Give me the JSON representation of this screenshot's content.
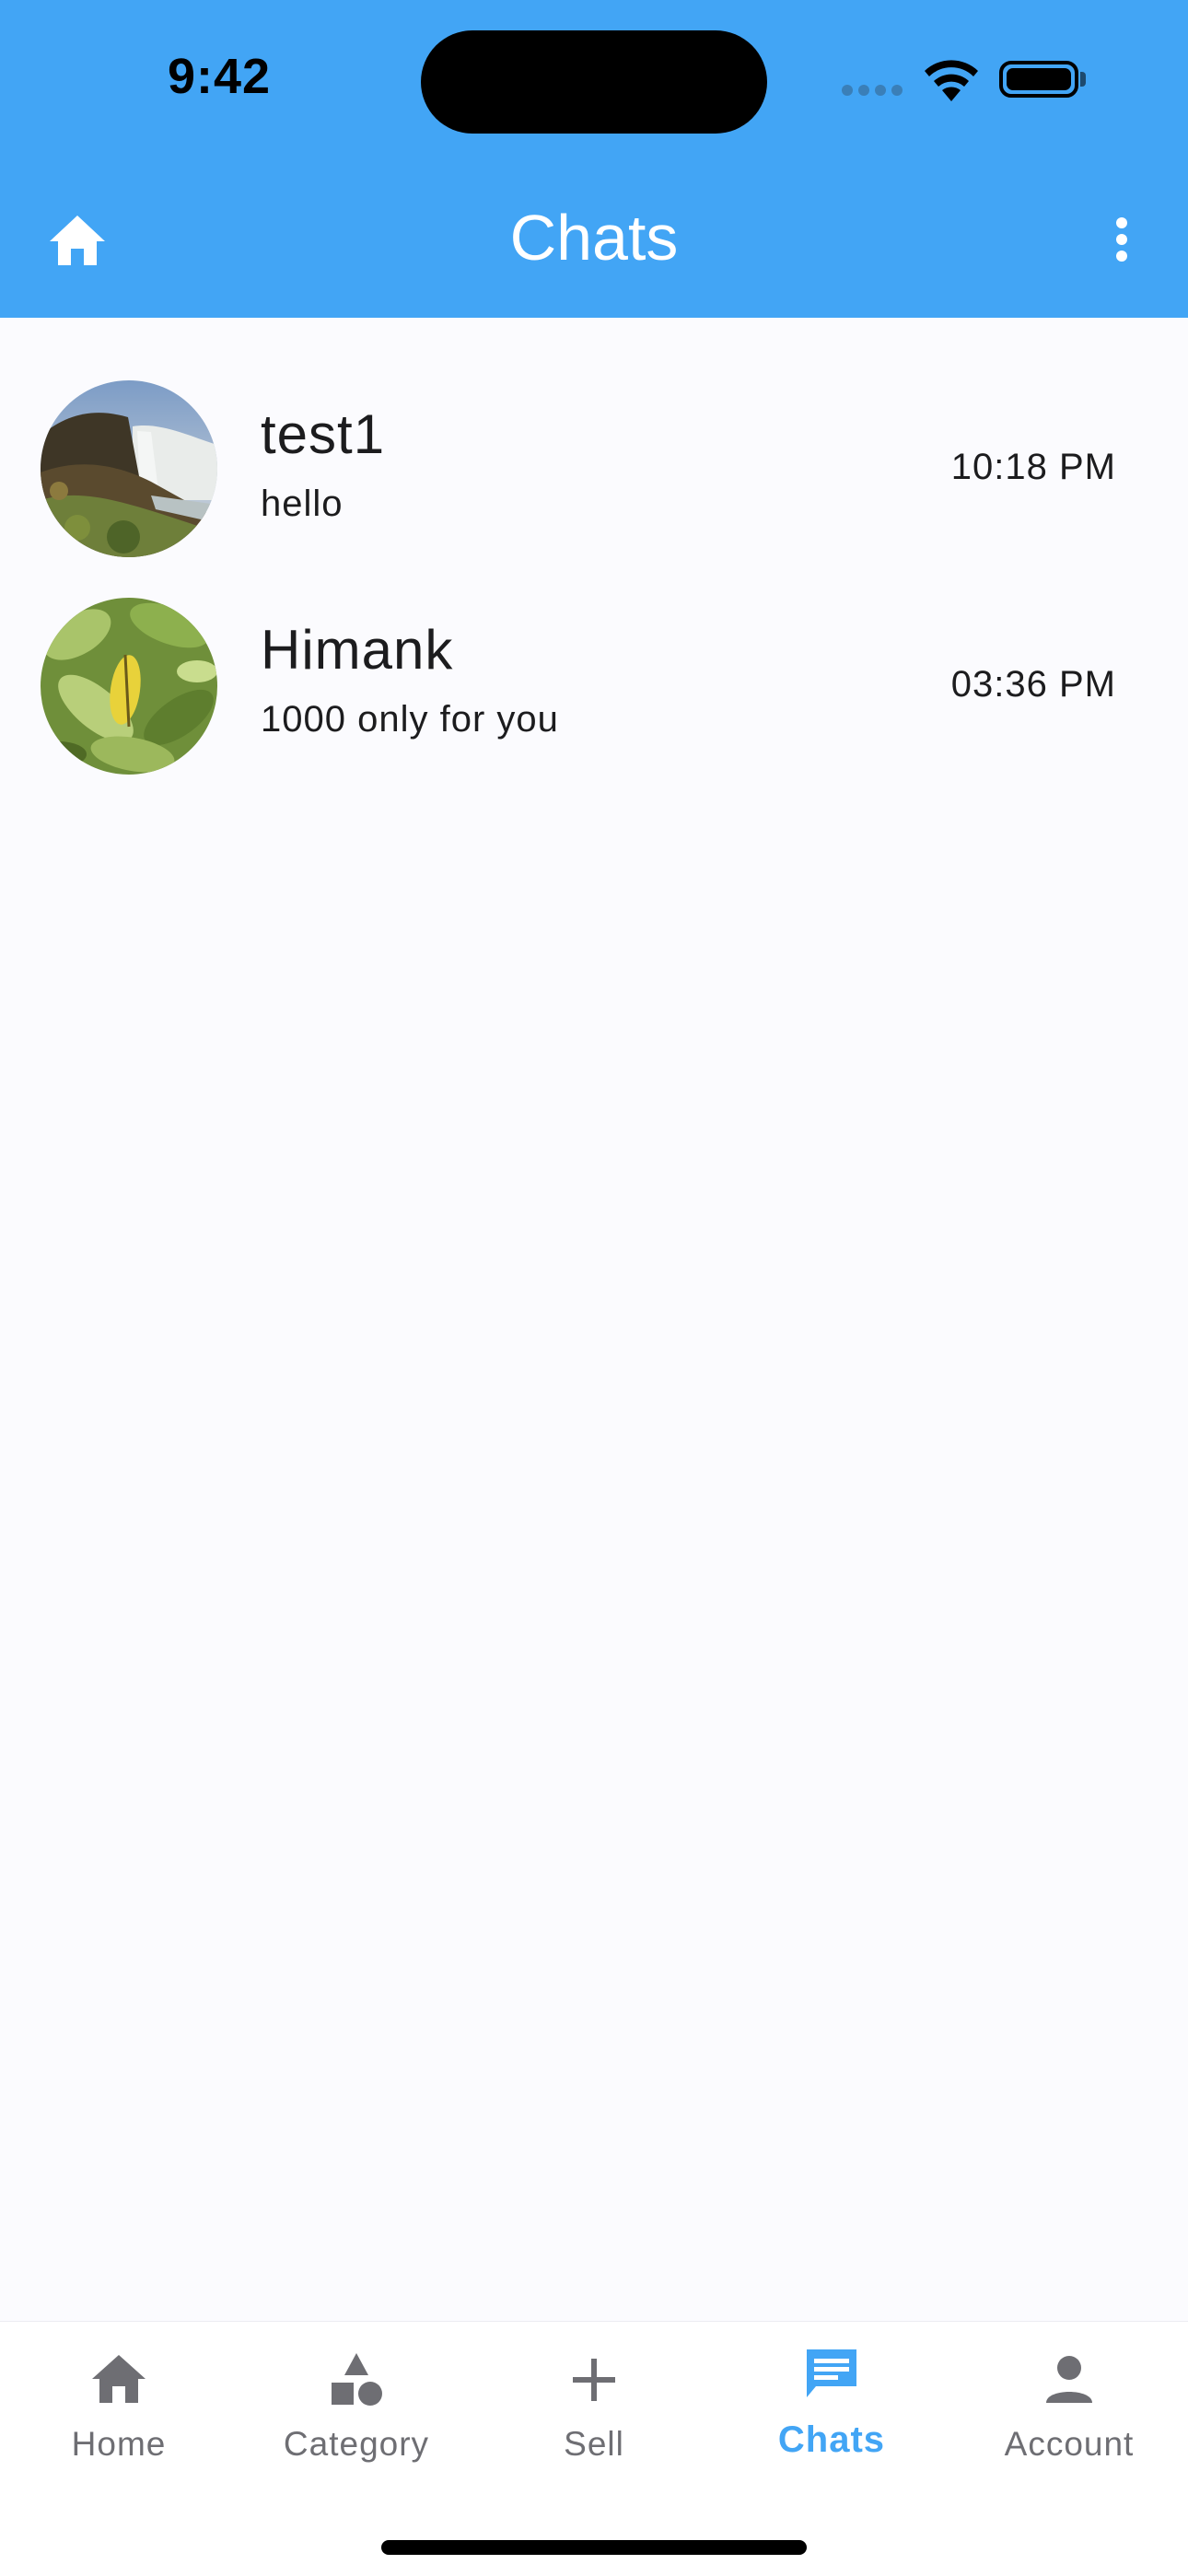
{
  "status_bar": {
    "time": "9:42"
  },
  "app_bar": {
    "title": "Chats",
    "left_icon": "home-icon",
    "right_icon": "more-vert-icon",
    "background": "#42A5F5"
  },
  "chats": [
    {
      "name": "test1",
      "last_message": "hello",
      "time": "10:18 PM",
      "avatar": "waterfall-photo"
    },
    {
      "name": "Himank",
      "last_message": "1000 only for you",
      "time": "03:36 PM",
      "avatar": "leaves-photo"
    }
  ],
  "bottom_nav": {
    "items": [
      {
        "label": "Home",
        "icon": "home-icon",
        "active": false
      },
      {
        "label": "Category",
        "icon": "category-icon",
        "active": false
      },
      {
        "label": "Sell",
        "icon": "plus-icon",
        "active": false
      },
      {
        "label": "Chats",
        "icon": "chat-icon",
        "active": true
      },
      {
        "label": "Account",
        "icon": "person-icon",
        "active": false
      }
    ],
    "active_color": "#42A5F5",
    "inactive_color": "#6E6E73"
  }
}
